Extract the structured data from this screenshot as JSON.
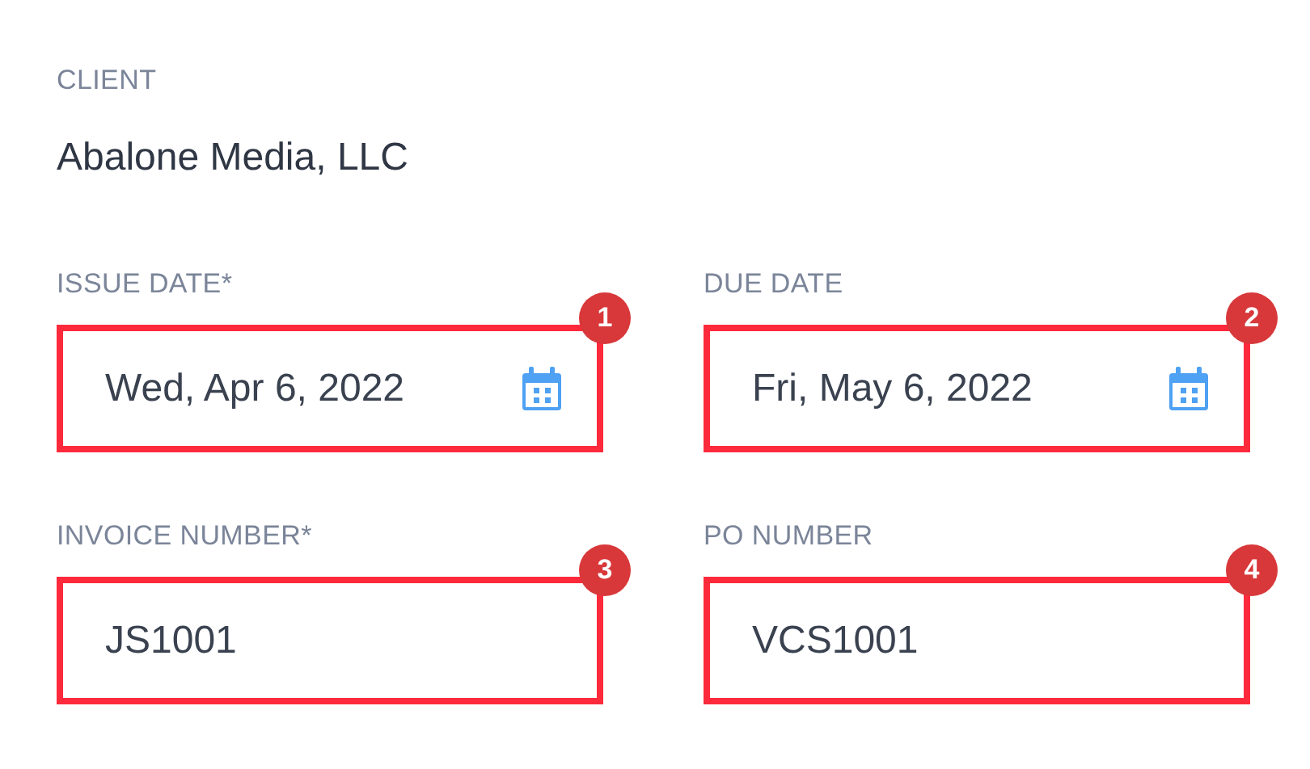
{
  "client": {
    "label": "CLIENT",
    "value": "Abalone Media, LLC"
  },
  "fields": [
    {
      "label": "ISSUE DATE*",
      "value": "Wed, Apr 6, 2022",
      "kind": "date",
      "badge": "1"
    },
    {
      "label": "DUE DATE",
      "value": "Fri, May 6, 2022",
      "kind": "date",
      "badge": "2"
    },
    {
      "label": "INVOICE NUMBER*",
      "value": "JS1001",
      "kind": "text",
      "badge": "3"
    },
    {
      "label": "PO NUMBER",
      "value": "VCS1001",
      "kind": "text",
      "badge": "4"
    }
  ]
}
